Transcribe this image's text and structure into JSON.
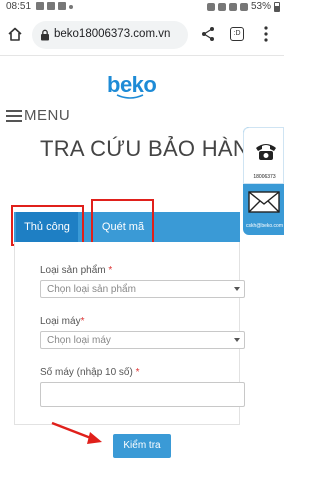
{
  "status_bar": {
    "time": "08:51",
    "battery": "53%"
  },
  "browser": {
    "url": "beko18006373.com.vn"
  },
  "header": {
    "logo": "beko",
    "menu_label": "MENU"
  },
  "page": {
    "title": "TRA CỨU BẢO HÀNH"
  },
  "contact": {
    "phone": "18006373",
    "email": "cskh@beko.com"
  },
  "tabs": [
    {
      "label": "Thủ công"
    },
    {
      "label": "Quét mã"
    }
  ],
  "form": {
    "product_type": {
      "label": "Loại sản phẩm",
      "required_mark": "*",
      "placeholder": "Chọn loại sản phẩm"
    },
    "machine_type": {
      "label": "Loại máy",
      "required_mark": "*",
      "placeholder": "Chọn loại máy"
    },
    "serial": {
      "label": "Số máy (nhập 10 số)",
      "required_mark": "*",
      "value": ""
    },
    "submit_label": "Kiểm tra"
  },
  "colors": {
    "accent": "#3a9ad6",
    "active_tab": "#1e7fc4",
    "highlight": "#e0201b",
    "brand": "#1e8bd6"
  }
}
